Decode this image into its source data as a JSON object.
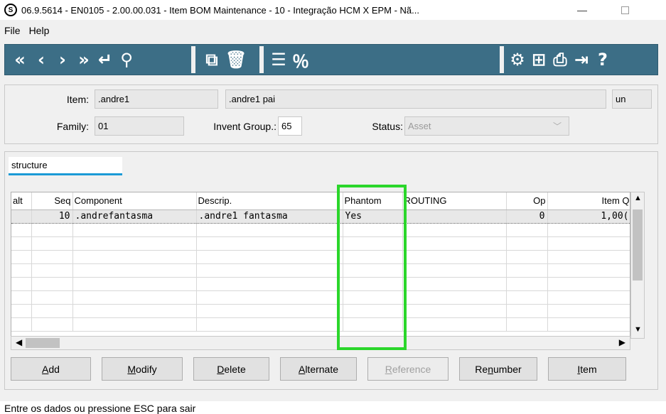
{
  "window": {
    "title": "06.9.5614 - EN0105 - 2.00.00.031 - Item BOM Maintenance - 10 - Integração HCM X EPM - Nã...",
    "minimize": "—"
  },
  "menu": [
    "File",
    "Help"
  ],
  "toolbar": {
    "left": [
      {
        "icon": "first-record-icon",
        "glyph": "«"
      },
      {
        "icon": "previous-record-icon",
        "glyph": "‹"
      },
      {
        "icon": "next-record-icon",
        "glyph": "›"
      },
      {
        "icon": "last-record-icon",
        "glyph": "»"
      },
      {
        "icon": "goto-icon",
        "glyph": "↵"
      },
      {
        "icon": "search-icon",
        "glyph": "⚲"
      }
    ],
    "middle": [
      {
        "icon": "copy-icon",
        "glyph": "⧉"
      },
      {
        "icon": "delete-icon",
        "glyph": "🗑"
      }
    ],
    "middle2": [
      {
        "icon": "list-alert-icon",
        "glyph": "☰"
      },
      {
        "icon": "percent-tool-icon",
        "glyph": "％"
      }
    ],
    "right": [
      {
        "icon": "settings-sliders-icon",
        "glyph": "⚙"
      },
      {
        "icon": "tree-structure-icon",
        "glyph": "⊞"
      },
      {
        "icon": "print-icon",
        "glyph": "⎙"
      },
      {
        "icon": "exit-icon",
        "glyph": "⇥"
      },
      {
        "icon": "help-icon",
        "glyph": "?"
      }
    ]
  },
  "header": {
    "item_label": "Item:",
    "item_code": ".andre1",
    "item_desc": ".andre1 pai",
    "unit": "un",
    "family_label": "Family:",
    "family": "01",
    "invent_group_label": "Invent Group.:",
    "invent_group": "65",
    "status_label": "Status:",
    "status": "Asset"
  },
  "tabs": [
    "structure"
  ],
  "grid": {
    "columns": [
      "alt",
      "Seq",
      "Component",
      "Descrip.",
      "Phantom",
      "ROUTING",
      "Op",
      "Item Q"
    ],
    "rows": [
      {
        "alt": "",
        "seq": "10",
        "component": ".andrefantasma",
        "descrip": ".andre1 fantasma",
        "phantom": "Yes",
        "routing": "",
        "op": "0",
        "qty": "1,00("
      }
    ],
    "empty_rows": 8
  },
  "buttons": [
    {
      "pre": "",
      "u": "A",
      "post": "dd",
      "name": "add-button",
      "enabled": true
    },
    {
      "pre": "",
      "u": "M",
      "post": "odify",
      "name": "modify-button",
      "enabled": true
    },
    {
      "pre": "",
      "u": "D",
      "post": "elete",
      "name": "delete-button",
      "enabled": true
    },
    {
      "pre": "",
      "u": "A",
      "post": "lternate",
      "name": "alternate-button",
      "enabled": true
    },
    {
      "pre": "",
      "u": "R",
      "post": "eference",
      "name": "reference-button",
      "enabled": false
    },
    {
      "pre": "Re",
      "u": "n",
      "post": "umber",
      "name": "renumber-button",
      "enabled": true
    },
    {
      "pre": "",
      "u": "I",
      "post": "tem",
      "name": "item-button",
      "enabled": true
    }
  ],
  "status_bar": "Entre os dados ou pressione ESC para sair"
}
